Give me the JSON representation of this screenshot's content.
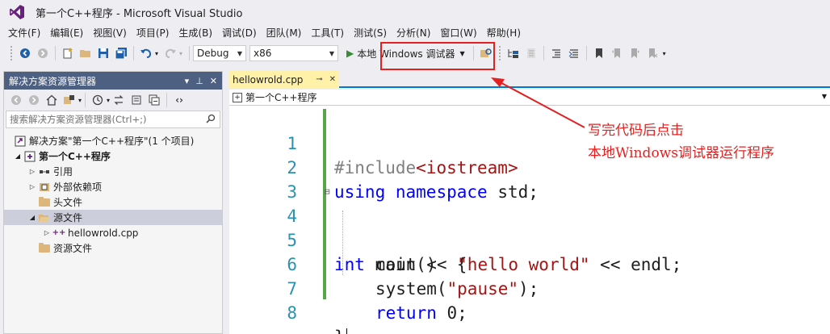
{
  "window": {
    "title": "第一个C++程序 - Microsoft Visual Studio"
  },
  "menu": [
    "文件(F)",
    "编辑(E)",
    "视图(V)",
    "项目(P)",
    "生成(B)",
    "调试(D)",
    "团队(M)",
    "工具(T)",
    "测试(S)",
    "分析(N)",
    "窗口(W)",
    "帮助(H)"
  ],
  "toolbar": {
    "config": "Debug",
    "platform": "x86",
    "run_label": "本地 Windows 调试器"
  },
  "solution_explorer": {
    "title": "解决方案资源管理器",
    "search_placeholder": "搜索解决方案资源管理器(Ctrl+;)",
    "tree": [
      {
        "label": "解决方案\"第一个C++程序\"(1 个项目)",
        "icon": "solution-icon",
        "level": 0
      },
      {
        "label": "第一个C++程序",
        "icon": "project-icon",
        "level": 1,
        "bold": true
      },
      {
        "label": "引用",
        "icon": "references-icon",
        "level": 2
      },
      {
        "label": "外部依赖项",
        "icon": "external-deps-icon",
        "level": 2
      },
      {
        "label": "头文件",
        "icon": "folder-icon",
        "level": 2
      },
      {
        "label": "源文件",
        "icon": "folder-open-icon",
        "level": 2,
        "selected": true
      },
      {
        "label": "hellowrold.cpp",
        "icon": "cpp-file-icon",
        "level": 3
      },
      {
        "label": "资源文件",
        "icon": "folder-icon",
        "level": 2
      }
    ]
  },
  "editor": {
    "tab_label": "hellowrold.cpp",
    "nav_scope": "第一个C++程序",
    "line_numbers": [
      "1",
      "2",
      "3",
      "4",
      "5",
      "6",
      "7",
      "8"
    ],
    "code": {
      "l1_a": "#include",
      "l1_b": "<iostream>",
      "l2_a": "using",
      "l2_b": "namespace",
      "l2_c": "std;",
      "l4_a": "int",
      "l4_b": "main()  {",
      "l5_a": "cout << ",
      "l5_b": "\"hello world\"",
      "l5_c": " << endl;",
      "l6_a": "system(",
      "l6_b": "\"pause\"",
      "l6_c": ");",
      "l7_a": "return",
      "l7_b": " 0;",
      "l8": "}"
    }
  },
  "annotation": {
    "line1": "写完代码后点击",
    "line2": "本地Windows调试器运行程序"
  },
  "colors": {
    "annotation": "#e52020",
    "keyword": "#0000ff",
    "string": "#a31515",
    "line_number": "#2b91af",
    "change_bar": "#57a64a",
    "header_bg": "#4d6082"
  }
}
